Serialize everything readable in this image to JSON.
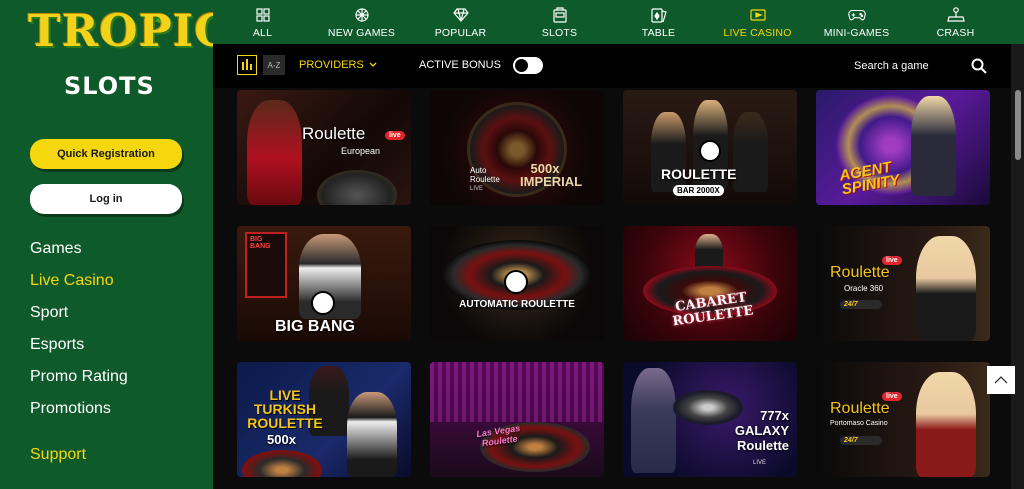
{
  "brand": {
    "logo_top": "TROPIC",
    "logo_bottom": "SLOTS"
  },
  "sidebar": {
    "register_label": "Quick Registration",
    "login_label": "Log in",
    "items": [
      {
        "label": "Games"
      },
      {
        "label": "Live Casino"
      },
      {
        "label": "Sport"
      },
      {
        "label": "Esports"
      },
      {
        "label": "Promo Rating"
      },
      {
        "label": "Promotions"
      }
    ],
    "support_label": "Support"
  },
  "topnav": {
    "items": [
      {
        "label": "ALL",
        "icon": "grid-icon"
      },
      {
        "label": "NEW GAMES",
        "icon": "sparkle-icon"
      },
      {
        "label": "POPULAR",
        "icon": "diamond-icon"
      },
      {
        "label": "SLOTS",
        "icon": "slot-machine-icon"
      },
      {
        "label": "TABLE",
        "icon": "cards-icon"
      },
      {
        "label": "LIVE CASINO",
        "icon": "live-video-icon"
      },
      {
        "label": "MINI-GAMES",
        "icon": "gamepad-icon"
      },
      {
        "label": "CRASH",
        "icon": "joystick-icon"
      }
    ]
  },
  "filterbar": {
    "sort_az": "A-Z",
    "providers_label": "PROVIDERS",
    "active_bonus_label": "ACTIVE BONUS",
    "search_placeholder": "Search a game"
  },
  "games": [
    {
      "title": "Roulette",
      "subtitle": "European",
      "badge": "live"
    },
    {
      "title": "Auto Roulette",
      "subtitle": "500x IMPERIAL",
      "badge": "LIVE"
    },
    {
      "title": "ROULETTE",
      "subtitle": "BAR 2000X"
    },
    {
      "title": "AGENT SPINITY"
    },
    {
      "title": "BIG BANG",
      "sign_top": "BIG BANG"
    },
    {
      "title": "AUTOMATIC ROULETTE"
    },
    {
      "title": "CABARET ROULETTE"
    },
    {
      "title": "Roulette",
      "subtitle": "Oracle 360",
      "badge": "live",
      "hours": "24/7"
    },
    {
      "title": "LIVE TURKISH ROULETTE",
      "subtitle": "500x"
    },
    {
      "title": "Las Vegas Roulette"
    },
    {
      "title": "777x GALAXY Roulette",
      "badge": "LIVE"
    },
    {
      "title": "Roulette",
      "subtitle": "Portomaso Casino",
      "badge": "live",
      "hours": "24/7"
    }
  ],
  "colors": {
    "sidebar_green": "#0f5a2a",
    "accent_yellow": "#f5d70d",
    "live_red": "#e0262b"
  }
}
